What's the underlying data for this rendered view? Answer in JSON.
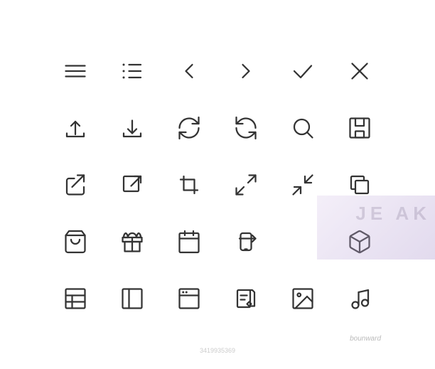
{
  "icons": [
    {
      "name": "hamburger-menu-icon",
      "row": 1,
      "col": 1
    },
    {
      "name": "list-icon",
      "row": 1,
      "col": 2
    },
    {
      "name": "arrow-left-icon",
      "row": 1,
      "col": 3
    },
    {
      "name": "arrow-right-icon",
      "row": 1,
      "col": 4
    },
    {
      "name": "checkmark-icon",
      "row": 1,
      "col": 5
    },
    {
      "name": "close-icon",
      "row": 1,
      "col": 6
    },
    {
      "name": "upload-icon",
      "row": 2,
      "col": 1
    },
    {
      "name": "download-icon",
      "row": 2,
      "col": 2
    },
    {
      "name": "refresh-cw-icon",
      "row": 2,
      "col": 3
    },
    {
      "name": "refresh-ccw-icon",
      "row": 2,
      "col": 4
    },
    {
      "name": "search-icon",
      "row": 2,
      "col": 5
    },
    {
      "name": "save-icon",
      "row": 2,
      "col": 6
    },
    {
      "name": "share-icon",
      "row": 3,
      "col": 1
    },
    {
      "name": "external-link-icon",
      "row": 3,
      "col": 2
    },
    {
      "name": "crop-icon",
      "row": 3,
      "col": 3
    },
    {
      "name": "expand-icon",
      "row": 3,
      "col": 4
    },
    {
      "name": "compress-icon",
      "row": 3,
      "col": 5
    },
    {
      "name": "layers-icon",
      "row": 3,
      "col": 6
    },
    {
      "name": "shopping-bag-icon",
      "row": 4,
      "col": 1
    },
    {
      "name": "gift-icon",
      "row": 4,
      "col": 2
    },
    {
      "name": "calendar-icon",
      "row": 4,
      "col": 3
    },
    {
      "name": "phone-rotate-icon",
      "row": 4,
      "col": 4
    },
    {
      "name": "box-3d-icon",
      "row": 4,
      "col": 6
    },
    {
      "name": "table-icon",
      "row": 5,
      "col": 1
    },
    {
      "name": "sidebar-icon",
      "row": 5,
      "col": 2
    },
    {
      "name": "browser-icon",
      "row": 5,
      "col": 3
    },
    {
      "name": "edit-icon",
      "row": 5,
      "col": 4
    },
    {
      "name": "image-icon",
      "row": 5,
      "col": 5
    },
    {
      "name": "music-icon",
      "row": 5,
      "col": 6
    }
  ],
  "watermark": {
    "text": "bounward",
    "badge": "3419935369"
  },
  "overlay_text": "JE AK"
}
